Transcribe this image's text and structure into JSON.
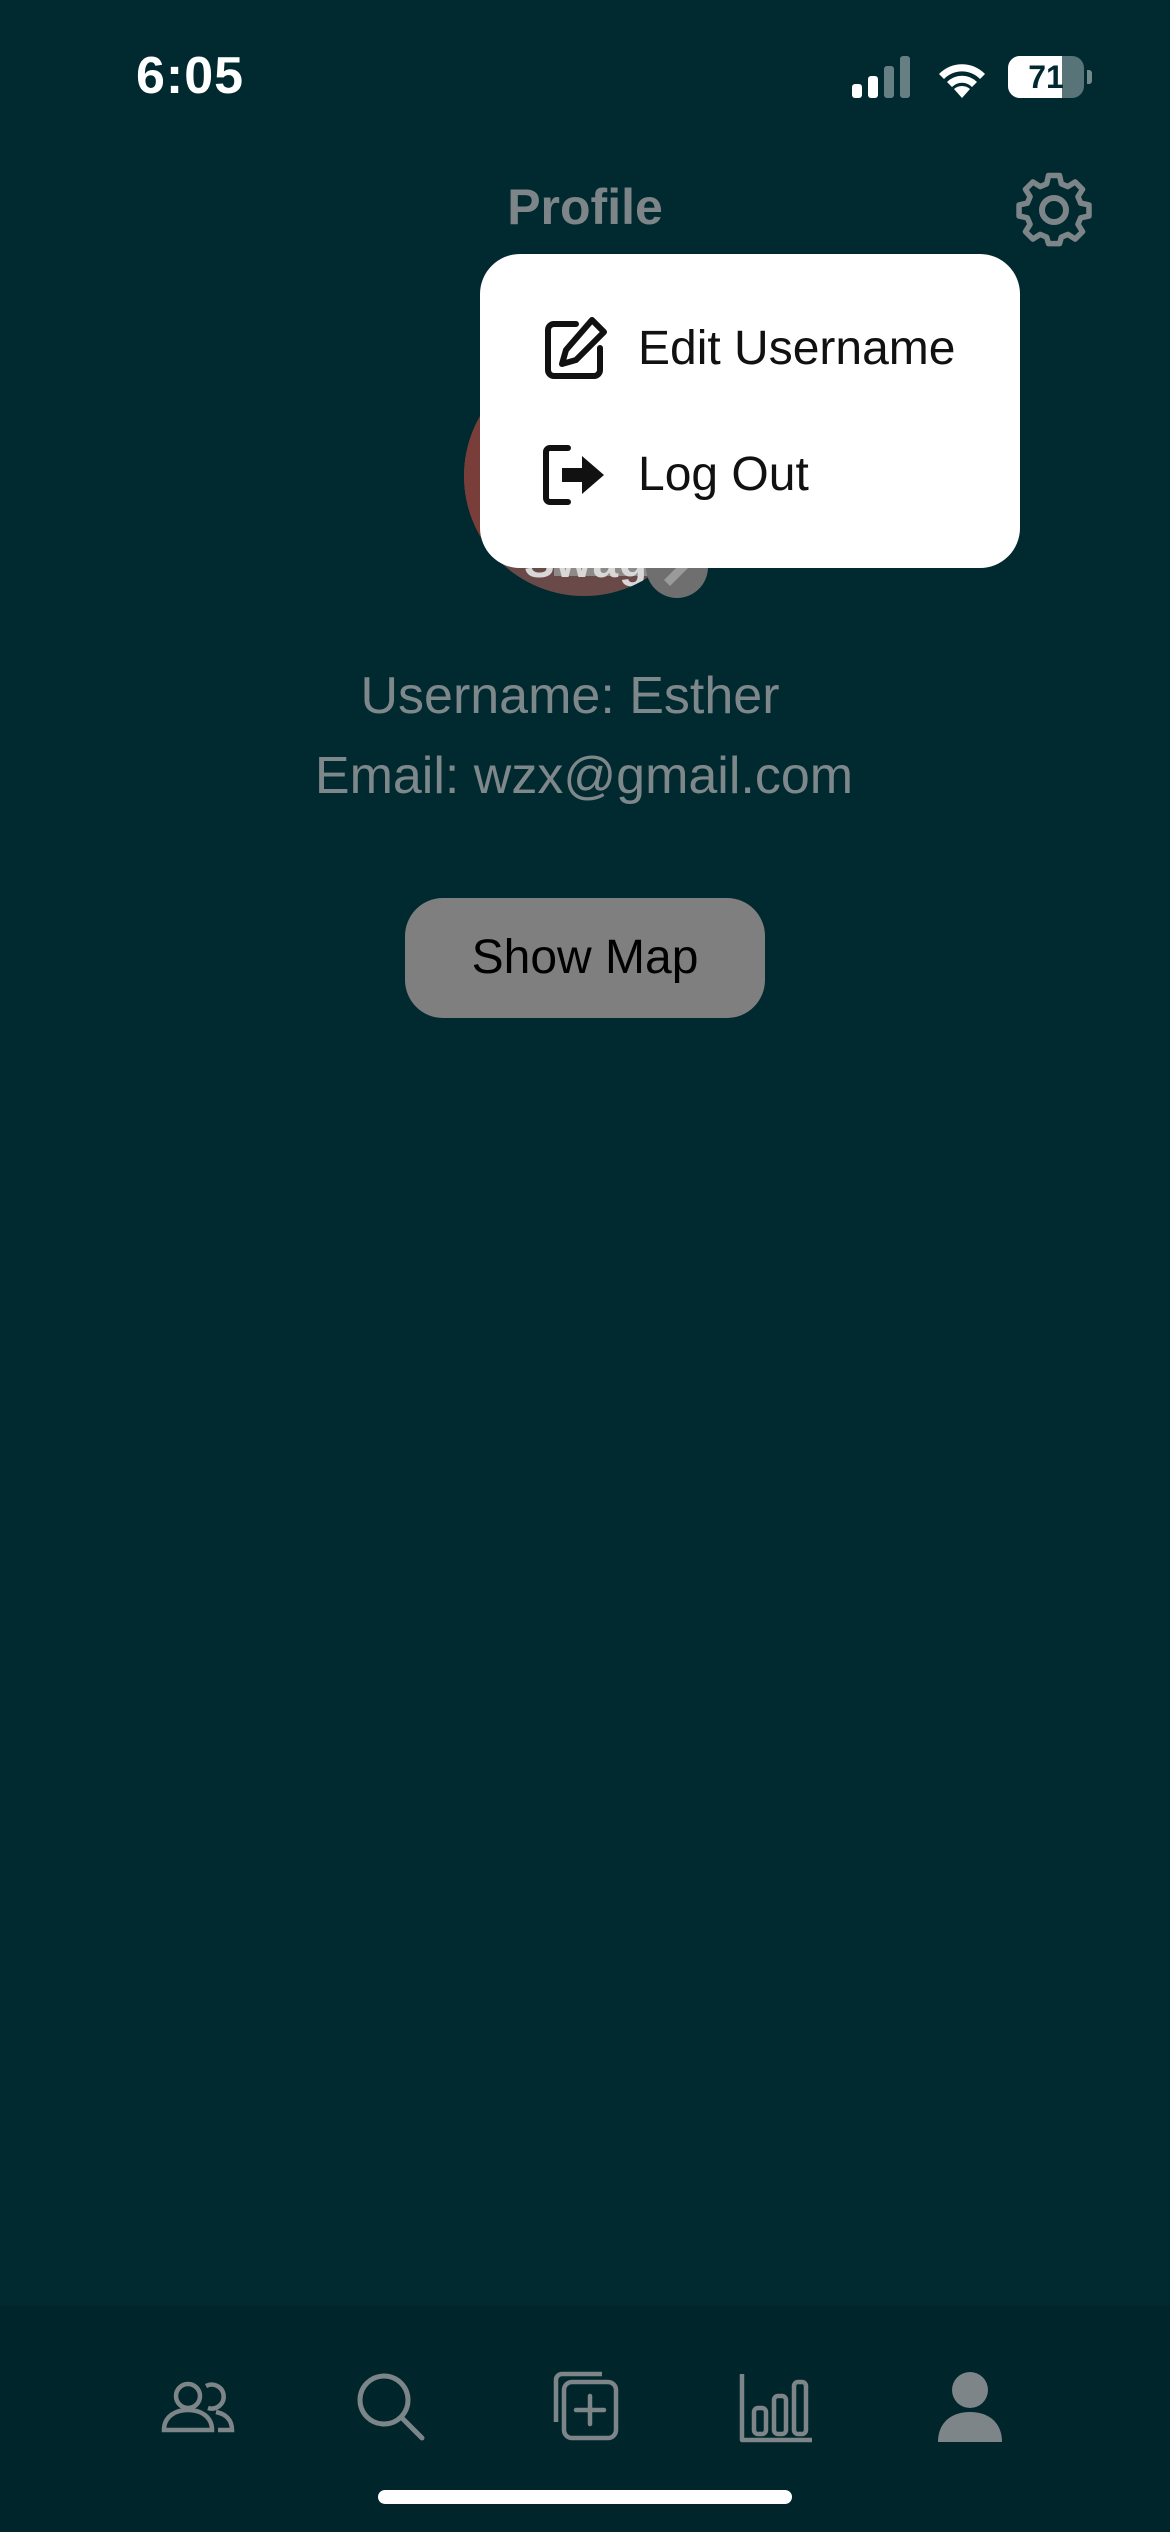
{
  "status_bar": {
    "time": "6:05",
    "battery_level": "71",
    "battery_fraction": 0.71
  },
  "header": {
    "title": "Profile"
  },
  "avatar": {
    "overlay_text": "Swag"
  },
  "profile": {
    "username_line": "Username: Esther",
    "email_line": "Email: wzx@gmail.com"
  },
  "actions": {
    "show_map_label": "Show Map"
  },
  "settings_menu": {
    "items": [
      {
        "label": "Edit Username",
        "icon": "edit-icon"
      },
      {
        "label": "Log Out",
        "icon": "logout-icon"
      }
    ]
  },
  "tab_bar": {
    "items": [
      {
        "icon": "friends-icon"
      },
      {
        "icon": "search-icon"
      },
      {
        "icon": "add-post-icon"
      },
      {
        "icon": "stats-icon"
      },
      {
        "icon": "profile-icon",
        "active": true
      }
    ]
  },
  "colors": {
    "background": "#002a30",
    "tab_bar": "#00262b",
    "muted_text": "#7e878a",
    "button_gray": "#7f7f7f",
    "menu_background": "#ffffff"
  }
}
